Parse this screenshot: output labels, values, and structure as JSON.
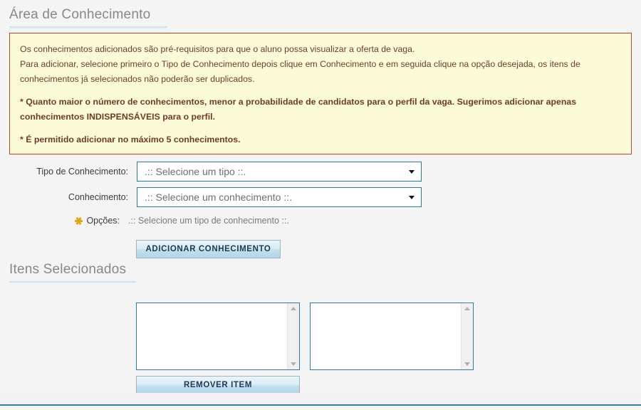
{
  "page": {
    "background_color": "#f4f4f4",
    "footer_rule_color": "#2f7fa5"
  },
  "sections": {
    "area_conhecimento": {
      "title": "Área de Conhecimento"
    },
    "itens_selecionados": {
      "title": "Itens Selecionados"
    }
  },
  "info_box": {
    "background_color": "#fcfbd8",
    "border_color": "#b5472a",
    "text_color": "#6d3b2e",
    "lines": [
      "Os conhecimentos adicionados são pré-requisitos para que o aluno possa visualizar a oferta de vaga.",
      "Para adicionar, selecione primeiro o Tipo de Conhecimento depois clique em Conhecimento e em seguida clique na opção desejada, os itens de",
      "conhecimentos já selecionados não poderão ser duplicados."
    ],
    "notes": [
      "* Quanto maior o número de conhecimentos, menor a probabilidade de candidatos para o perfil da vaga. Sugerimos adicionar apenas",
      "conhecimentos INDISPENSÁVEIS para o perfil."
    ],
    "limit_note": "* É permitido adicionar no máximo 5 conhecimentos."
  },
  "form": {
    "tipo_conhecimento": {
      "label": "Tipo de Conhecimento:",
      "value": ".:: Selecione um tipo ::.",
      "caret_icon": "chevron-down-icon"
    },
    "conhecimento": {
      "label": "Conhecimento:",
      "value": ".:: Selecione um conhecimento ::.",
      "caret_icon": "chevron-down-icon"
    },
    "opcoes": {
      "icon": "asterisk-icon",
      "icon_color": "#e0a716",
      "label": "Opções:",
      "value": ".:: Selecione um tipo de conhecimento ::."
    },
    "add_button": {
      "label": "ADICIONAR CONHECIMENTO"
    }
  },
  "selected_items": {
    "left_list": {
      "items": [],
      "scrollbar": {
        "up_icon": "scroll-up-arrow-icon",
        "down_icon": "scroll-down-arrow-icon"
      }
    },
    "right_list": {
      "items": [],
      "scrollbar": {
        "up_icon": "scroll-up-arrow-icon",
        "down_icon": "scroll-down-arrow-icon"
      }
    },
    "remove_button": {
      "label": "REMOVER ITEM"
    }
  }
}
